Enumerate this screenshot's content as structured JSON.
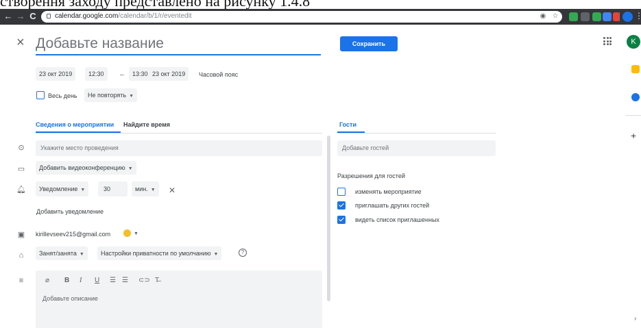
{
  "caption": "створення заходу представлено на рисунку 1.4.8",
  "browser": {
    "back": "←",
    "forward": "→",
    "reload": "C",
    "url_host": "calendar.google.com",
    "url_path": "/calendar/b/1/r/eventedit"
  },
  "event": {
    "title_placeholder": "Добавьте название",
    "save_label": "Сохранить",
    "avatar_letter": "K",
    "start_date": "23 окт 2019",
    "start_time": "12:30",
    "dash": "–",
    "end_time": "13:30",
    "end_date": "23 окт 2019",
    "timezone_label": "Часовой пояс",
    "all_day_label": "Весь день",
    "repeat_label": "Не повторять"
  },
  "tabs": {
    "details": "Сведения о мероприятии",
    "find_time": "Найдите время",
    "guests": "Гости"
  },
  "details": {
    "location_placeholder": "Укажите место проведения",
    "video_label": "Добавить видеоконференцию",
    "notification_type": "Уведомление",
    "notification_value": "30",
    "notification_unit": "мин.",
    "add_notification": "Добавить уведомление",
    "calendar_owner": "kirillevseev215@gmail.com",
    "busy_label": "Занят/занята",
    "privacy_label": "Настройки приватности по умолчанию",
    "description_placeholder": "Добавьте описание"
  },
  "guests": {
    "add_placeholder": "Добавьте гостей",
    "permissions_title": "Разрешения для гостей",
    "permissions": [
      {
        "label": "изменять мероприятие",
        "checked": false
      },
      {
        "label": "приглашать других гостей",
        "checked": true
      },
      {
        "label": "видеть список приглашенных",
        "checked": true
      }
    ]
  },
  "colors": {
    "accent": "#1a73e8",
    "event_color": "#f6bf26",
    "avatar": "#0b8043"
  }
}
